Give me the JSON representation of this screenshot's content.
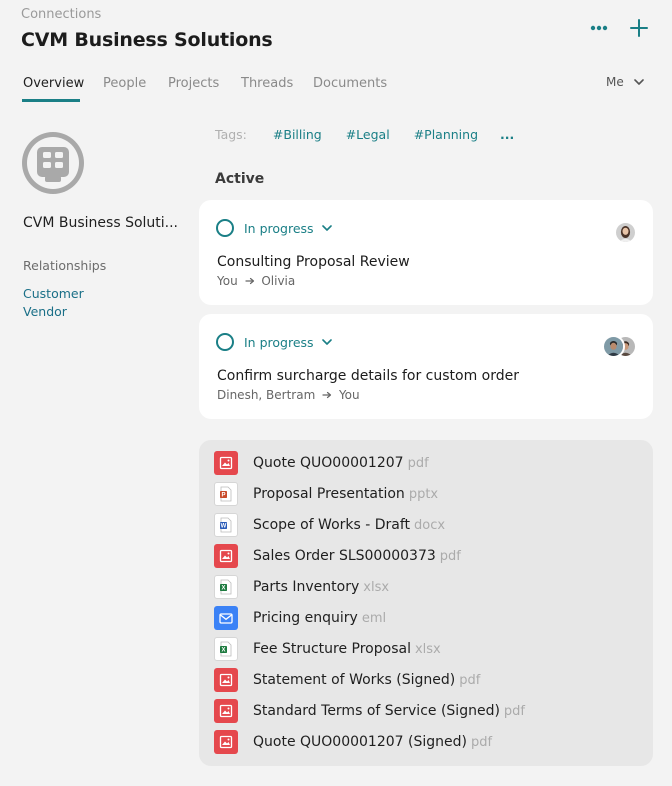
{
  "header": {
    "breadcrumb": "Connections",
    "title": "CVM Business Solutions",
    "more_icon": "more-horizontal-icon",
    "add_icon": "plus-icon"
  },
  "tabs": [
    {
      "label": "Overview",
      "active": true
    },
    {
      "label": "People",
      "active": false
    },
    {
      "label": "Projects",
      "active": false
    },
    {
      "label": "Threads",
      "active": false
    },
    {
      "label": "Documents",
      "active": false
    }
  ],
  "filter": {
    "label": "Me"
  },
  "sidebar": {
    "org_name": "CVM Business Soluti...",
    "relationships_label": "Relationships",
    "relationships": [
      "Customer",
      "Vendor"
    ]
  },
  "tags": {
    "label": "Tags:",
    "items": [
      "#Billing",
      "#Legal",
      "#Planning"
    ],
    "more": "..."
  },
  "active_section": {
    "heading": "Active",
    "items": [
      {
        "status": "In progress",
        "title": "Consulting Proposal Review",
        "from": "You",
        "to": "Olivia"
      },
      {
        "status": "In progress",
        "title": "Confirm surcharge details for custom order",
        "from": "Dinesh, Bertram",
        "to": "You"
      }
    ]
  },
  "documents": [
    {
      "name": "Quote QUO00001207",
      "ext": "pdf",
      "icon": "pdf-icon"
    },
    {
      "name": "Proposal Presentation",
      "ext": "pptx",
      "icon": "pptx-icon"
    },
    {
      "name": "Scope of Works - Draft",
      "ext": "docx",
      "icon": "docx-icon"
    },
    {
      "name": "Sales Order SLS00000373",
      "ext": "pdf",
      "icon": "pdf-icon"
    },
    {
      "name": "Parts Inventory",
      "ext": "xlsx",
      "icon": "xlsx-icon"
    },
    {
      "name": "Pricing enquiry",
      "ext": "eml",
      "icon": "email-icon"
    },
    {
      "name": "Fee Structure Proposal",
      "ext": "xlsx",
      "icon": "xlsx-icon"
    },
    {
      "name": "Statement of Works (Signed)",
      "ext": "pdf",
      "icon": "pdf-icon"
    },
    {
      "name": "Standard Terms of Service (Signed)",
      "ext": "pdf",
      "icon": "pdf-icon"
    },
    {
      "name": "Quote QUO00001207 (Signed)",
      "ext": "pdf",
      "icon": "pdf-icon"
    }
  ],
  "colors": {
    "accent": "#1a7f86",
    "link": "#1a6f87",
    "pdf": "#e5484d",
    "email": "#3b82f6",
    "excel": "#1d7a3f",
    "word": "#2b5cb8",
    "powerpoint": "#c94a2a"
  }
}
